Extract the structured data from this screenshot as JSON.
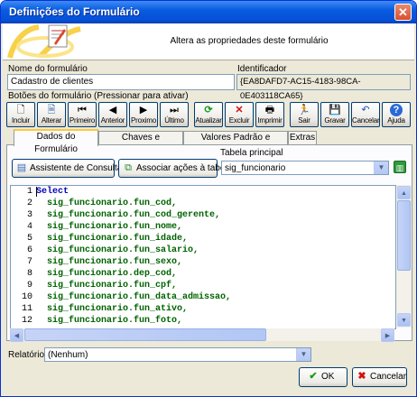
{
  "window": {
    "title": "Definições do Formulário",
    "close_icon": "close-icon"
  },
  "banner": {
    "description": "Altera as propriedades deste formulário"
  },
  "form": {
    "name_label": "Nome do formulário",
    "name_value": "Cadastro de clientes",
    "id_label": "Identificador",
    "id_value": "{EA8DAFD7-AC15-4183-98CA-0E403118CA65}"
  },
  "toolbar": {
    "label": "Botões do formulário (Pressionar para ativar)",
    "buttons": [
      {
        "label": "Incluir",
        "icon": "new-document-icon"
      },
      {
        "label": "Alterar",
        "icon": "edit-document-icon"
      },
      {
        "label": "Primeiro",
        "icon": "first-record-icon"
      },
      {
        "label": "Anterior",
        "icon": "previous-record-icon"
      },
      {
        "label": "Proximo",
        "icon": "next-record-icon"
      },
      {
        "label": "Último",
        "icon": "last-record-icon"
      },
      {
        "label": "Atualizar",
        "icon": "refresh-icon"
      },
      {
        "label": "Excluir",
        "icon": "delete-icon"
      },
      {
        "label": "Imprimir",
        "icon": "print-icon"
      },
      {
        "label": "Sair",
        "icon": "exit-icon"
      },
      {
        "label": "Gravar",
        "icon": "save-icon"
      },
      {
        "label": "Cancelar",
        "icon": "undo-icon"
      },
      {
        "label": "Ajuda",
        "icon": "help-icon"
      }
    ]
  },
  "tabs": [
    {
      "label": "Dados do Formulário",
      "active": true
    },
    {
      "label": "Chaves e Atualização",
      "active": false
    },
    {
      "label": "Valores Padrão e Máscaras",
      "active": false
    },
    {
      "label": "Extras",
      "active": false
    }
  ],
  "panel": {
    "query_assistant_label": "Assistente de Consulta",
    "associate_actions_label": "Associar ações à tabela",
    "main_table_label": "Tabela principal",
    "main_table_value": "sig_funcionario"
  },
  "editor": {
    "lines": [
      {
        "num": "1",
        "text": "Select",
        "kind": "kw"
      },
      {
        "num": "2",
        "text": "  sig_funcionario.fun_cod,",
        "kind": "fld"
      },
      {
        "num": "3",
        "text": "  sig_funcionario.fun_cod_gerente,",
        "kind": "fld"
      },
      {
        "num": "4",
        "text": "  sig_funcionario.fun_nome,",
        "kind": "fld"
      },
      {
        "num": "5",
        "text": "  sig_funcionario.fun_idade,",
        "kind": "fld"
      },
      {
        "num": "6",
        "text": "  sig_funcionario.fun_salario,",
        "kind": "fld"
      },
      {
        "num": "7",
        "text": "  sig_funcionario.fun_sexo,",
        "kind": "fld"
      },
      {
        "num": "8",
        "text": "  sig_funcionario.dep_cod,",
        "kind": "fld"
      },
      {
        "num": "9",
        "text": "  sig_funcionario.fun_cpf,",
        "kind": "fld"
      },
      {
        "num": "10",
        "text": "  sig_funcionario.fun_data_admissao,",
        "kind": "fld"
      },
      {
        "num": "11",
        "text": "  sig_funcionario.fun_ativo,",
        "kind": "fld"
      },
      {
        "num": "12",
        "text": "  sig_funcionario.fun_foto,",
        "kind": "fld"
      }
    ]
  },
  "report": {
    "label": "Relatório:",
    "value": "(Nenhum)"
  },
  "footer": {
    "ok_label": "OK",
    "cancel_label": "Cancelar"
  }
}
